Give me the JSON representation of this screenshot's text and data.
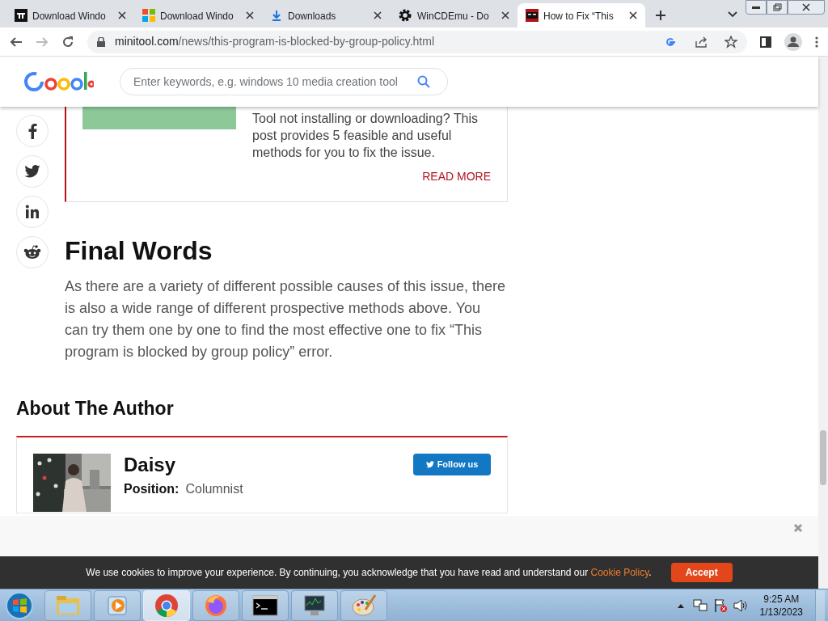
{
  "browser": {
    "tabs": [
      {
        "title": "Download Windo",
        "kind": "tw",
        "selected": false
      },
      {
        "title": "Download Windo",
        "kind": "windows",
        "selected": false
      },
      {
        "title": "Downloads",
        "kind": "download",
        "selected": false
      },
      {
        "title": "WinCDEmu - Do",
        "kind": "gear",
        "selected": false
      },
      {
        "title": "How to Fix “This",
        "kind": "mt",
        "selected": true
      }
    ],
    "url_host": "minitool.com",
    "url_path": "/news/this-program-is-blocked-by-group-policy.html"
  },
  "header": {
    "search": {
      "placeholder": "Enter keywords, e.g. windows 10 media creation tool"
    }
  },
  "share": [
    {
      "kind": "facebook"
    },
    {
      "kind": "twitter"
    },
    {
      "kind": "linkedin"
    },
    {
      "kind": "reddit"
    }
  ],
  "related_card": {
    "excerpt": "Tool not installing or downloading? This post provides 5 feasible and useful methods for you to fix the issue.",
    "link": "READ MORE"
  },
  "article": {
    "heading": "Final Words",
    "paragraph": "As there are a variety of different possible causes of this issue, there is also a wide range of different prospective methods above. You can try them one by one to find the most effective one to fix “This program is blocked by group policy” error."
  },
  "author": {
    "heading": "About The Author",
    "name": "Daisy",
    "position_label": "Position:",
    "position": "Columnist",
    "follow": "Follow us"
  },
  "cookie": {
    "text": "We use cookies to improve your experience. By continuing, you acknowledge that you have read and understand our ",
    "link": "Cookie Policy",
    "end": ".",
    "accept": "Accept"
  },
  "taskbar": {
    "apps": [
      {
        "kind": "explorer",
        "selected": false
      },
      {
        "kind": "media",
        "selected": false
      },
      {
        "kind": "chrome",
        "selected": true
      },
      {
        "kind": "firefox",
        "selected": false
      },
      {
        "kind": "cmd",
        "selected": false
      },
      {
        "kind": "monitor",
        "selected": false
      },
      {
        "kind": "paint",
        "selected": false
      }
    ],
    "time": "9:25 AM",
    "date": "1/13/2023"
  }
}
